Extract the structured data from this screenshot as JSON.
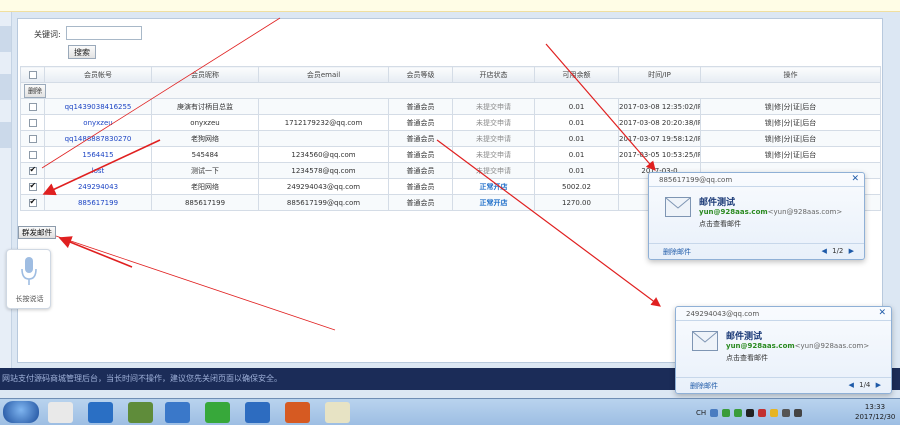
{
  "search": {
    "label": "关键词:",
    "placeholder": "",
    "button": "搜索"
  },
  "table": {
    "headers": [
      "",
      "会员帐号",
      "会员昵称",
      "会员email",
      "会员等级",
      "开店状态",
      "可用余额",
      "时间/IP",
      "操作"
    ],
    "delete_label": "删除",
    "rows": [
      {
        "checked": false,
        "account": "qq1439038416255",
        "nickname": "庚演有讨柄目总监",
        "email": "",
        "level": "普通会员",
        "status": "未提交申请",
        "balance": "0.01",
        "time": "2017-03-08 12:35:02/IP",
        "ops": "锁|修|分|证|后台"
      },
      {
        "checked": false,
        "account": "onyxzeu",
        "nickname": "onyxzeu",
        "email": "1712179232@qq.com",
        "level": "普通会员",
        "status": "未提交申请",
        "balance": "0.01",
        "time": "2017-03-08 20:20:38/IP",
        "ops": "锁|修|分|证|后台"
      },
      {
        "checked": false,
        "account": "qq1488887830270",
        "nickname": "老狗网络",
        "email": "",
        "level": "普通会员",
        "status": "未提交申请",
        "balance": "0.01",
        "time": "2017-03-07 19:58:12/IP",
        "ops": "锁|修|分|证|后台"
      },
      {
        "checked": false,
        "account": "1564415",
        "nickname": "545484",
        "email": "1234560@qq.com",
        "level": "普通会员",
        "status": "未提交申请",
        "balance": "0.01",
        "time": "2017-03-05 10:53:25/IP",
        "ops": "锁|修|分|证|后台"
      },
      {
        "checked": true,
        "account": "lost",
        "nickname": "测试一下",
        "email": "1234578@qq.com",
        "level": "普通会员",
        "status": "未提交申请",
        "balance": "0.01",
        "time": "2017-03-0",
        "ops": ""
      },
      {
        "checked": true,
        "account": "249294043",
        "nickname": "老阳网络",
        "email": "249294043@qq.com",
        "level": "普通会员",
        "status": "正常开店",
        "balance": "5002.02",
        "time": "",
        "ops": ""
      },
      {
        "checked": true,
        "account": "885617199",
        "nickname": "885617199",
        "email": "885617199@qq.com",
        "level": "普通会员",
        "status": "正常开店",
        "balance": "1270.00",
        "time": "",
        "ops": ""
      }
    ]
  },
  "bulk_mail_button": "群发邮件",
  "voice": {
    "label": "长按说话"
  },
  "statusbar": {
    "text": "网站支付源码商城管理后台，当长时间不操作，建议您先关闭页面以确保安全。"
  },
  "notify1": {
    "header": "885617199@qq.com",
    "title": "邮件测试",
    "from_email": "yun@928aas.com",
    "from_addr": "<yun@928aas.com>",
    "action": "点击查看邮件",
    "delete": "删除邮件",
    "pager": "1/2"
  },
  "notify2": {
    "header": "249294043@qq.com",
    "title": "邮件测试",
    "from_email": "yun@928aas.com",
    "from_addr": "<yun@928aas.com>",
    "action": "点击查看邮件",
    "delete": "删除邮件",
    "pager": "1/4"
  },
  "tray": {
    "text": "CH"
  },
  "clock": {
    "time": "13:33",
    "date": "2017/12/30"
  },
  "colors": {
    "arrow": "#e02020",
    "link": "#1d45c4",
    "statusbar": "#1b2c58"
  }
}
